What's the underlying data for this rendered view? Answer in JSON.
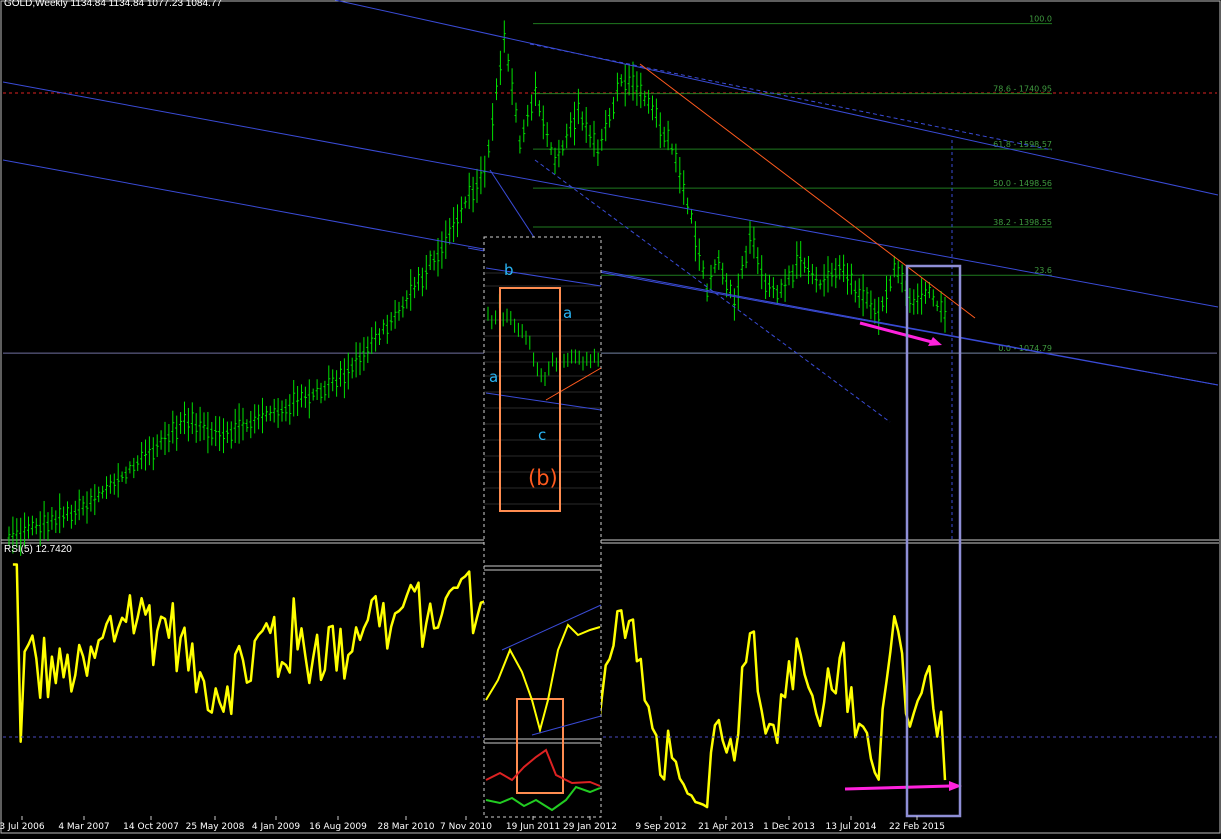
{
  "window": {
    "title": "GOLD,Weekly  1134.84 1134.84 1077.23 1084.77",
    "indicator_title": "RSI(5) 12.7420"
  },
  "colors": {
    "background": "#000000",
    "price_bars": "#00e000",
    "rsi_line": "#ffff00",
    "channel_lines": "#3a4bd6",
    "fib_lines": "#1f7a1f",
    "fib_labels": "#3f9a3f",
    "trendline": "#ff5a1e",
    "red_level": "#dd2222",
    "annotation_arrow": "#ff22dd",
    "highlight_box": "#8f8fd6",
    "inset_box": "#ff8c50",
    "wave_labels": "#29b6f6",
    "wave_b_label": "#ff5a1e"
  },
  "chart_data": [
    {
      "type": "bar",
      "name": "GOLD Weekly OHLC",
      "x_ticks": [
        "3 Jul 2006",
        "4 Mar 2007",
        "14 Oct 2007",
        "25 May 2008",
        "4 Jan 2009",
        "16 Aug 2009",
        "28 Mar 2010",
        "7 Nov 2010",
        "19 Jun 2011",
        "29 Jan 2012",
        "9 Sep 2012",
        "21 Apr 2013",
        "1 Dec 2013",
        "13 Jul 2014",
        "22 Feb 2015"
      ],
      "price_path": [
        [
          0,
          600
        ],
        [
          20,
          680
        ],
        [
          45,
          900
        ],
        [
          55,
          870
        ],
        [
          70,
          930
        ],
        [
          85,
          1010
        ],
        [
          100,
          1180
        ],
        [
          112,
          1360
        ],
        [
          118,
          1480
        ],
        [
          122,
          1540
        ],
        [
          127,
          1880
        ],
        [
          131,
          1620
        ],
        [
          135,
          1750
        ],
        [
          140,
          1560
        ],
        [
          146,
          1700
        ],
        [
          151,
          1590
        ],
        [
          157,
          1780
        ],
        [
          160,
          1760
        ],
        [
          165,
          1700
        ],
        [
          170,
          1600
        ],
        [
          175,
          1420
        ],
        [
          179,
          1240
        ],
        [
          182,
          1320
        ],
        [
          186,
          1200
        ],
        [
          190,
          1380
        ],
        [
          194,
          1260
        ],
        [
          198,
          1230
        ],
        [
          203,
          1320
        ],
        [
          208,
          1250
        ],
        [
          213,
          1300
        ],
        [
          218,
          1220
        ],
        [
          223,
          1180
        ],
        [
          227,
          1290
        ],
        [
          232,
          1200
        ],
        [
          236,
          1230
        ],
        [
          240,
          1165
        ]
      ],
      "ylim": [
        600,
        1925
      ],
      "fibonacci_levels": [
        {
          "label": "100.0",
          "value": 1920.94
        },
        {
          "label": "78.6 - 1740.95",
          "value": 1740.95
        },
        {
          "label": "61.8 - 1598.57",
          "value": 1598.57
        },
        {
          "label": "50.0 - 1498.56",
          "value": 1498.56
        },
        {
          "label": "38.2 - 1398.55",
          "value": 1398.55
        },
        {
          "label": "23.6",
          "value": 1274.8
        },
        {
          "label": "0.0 - 1074.79",
          "value": 1074.79
        }
      ],
      "wave_labels": [
        "b",
        "a",
        "a",
        "c",
        "(b)"
      ]
    },
    {
      "type": "line",
      "name": "RSI(5)",
      "last_value": 12.742,
      "ylim": [
        0,
        100
      ],
      "level": 30
    }
  ]
}
